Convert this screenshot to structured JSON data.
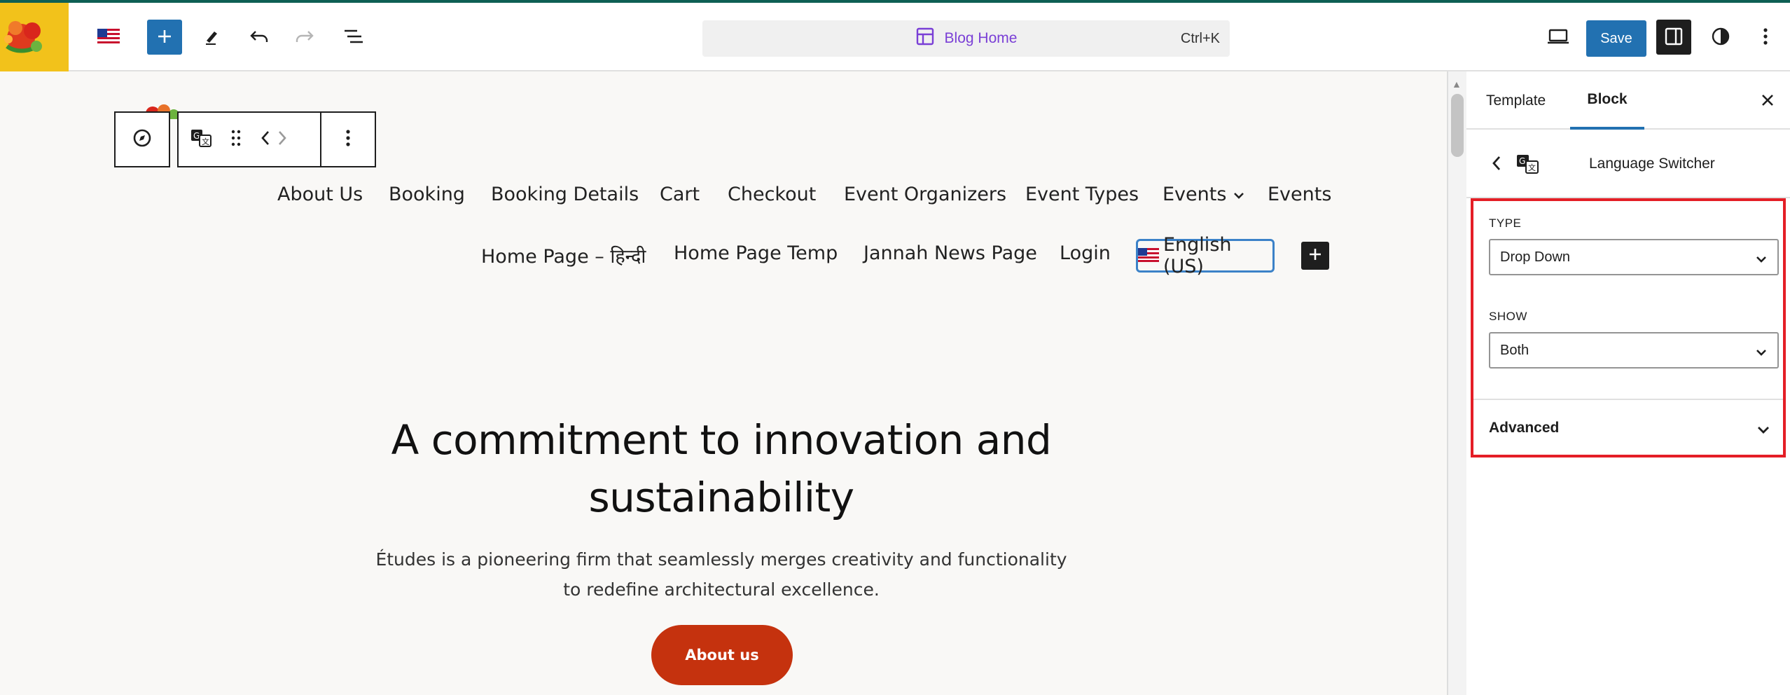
{
  "topbar": {
    "command_title": "Blog Home",
    "command_shortcut": "Ctrl+K",
    "save_label": "Save"
  },
  "canvas": {
    "nav_row1": [
      "About Us",
      "Booking",
      "Booking Details",
      "Cart",
      "Checkout",
      "Event Organizers",
      "Event Types",
      "Events",
      "Events"
    ],
    "nav_row2": [
      "Home Page – हिन्दी",
      "Home Page Temp",
      "Jannah News Page",
      "Login"
    ],
    "language_switcher_label": "English (US)",
    "hero_title": "A commitment to innovation and sustainability",
    "hero_desc": "Études is a pioneering firm that seamlessly merges creativity and functionality to redefine architectural excellence.",
    "hero_button": "About us"
  },
  "sidebar": {
    "tabs": [
      "Template",
      "Block"
    ],
    "active_tab": "Block",
    "block_name": "Language Switcher",
    "type_label": "TYPE",
    "type_value": "Drop Down",
    "show_label": "SHOW",
    "show_value": "Both",
    "advanced_label": "Advanced"
  },
  "colors": {
    "accent": "#2271b1",
    "brand_header": "#0e5f54",
    "hero_button": "#c5320e",
    "highlight_box": "#e41e26",
    "command_title": "#7a3fd6"
  },
  "icons": [
    "site-logo",
    "flag-us-icon",
    "plus-icon",
    "pen-icon",
    "undo-icon",
    "redo-icon",
    "list-view-icon",
    "template-icon",
    "desktop-view-icon",
    "sidebar-toggle-icon",
    "styles-icon",
    "more-options-icon",
    "compass-icon",
    "translate-icon",
    "drag-handle-icon",
    "chevron-left-icon",
    "chevron-right-icon",
    "close-icon",
    "chevron-down-icon"
  ]
}
